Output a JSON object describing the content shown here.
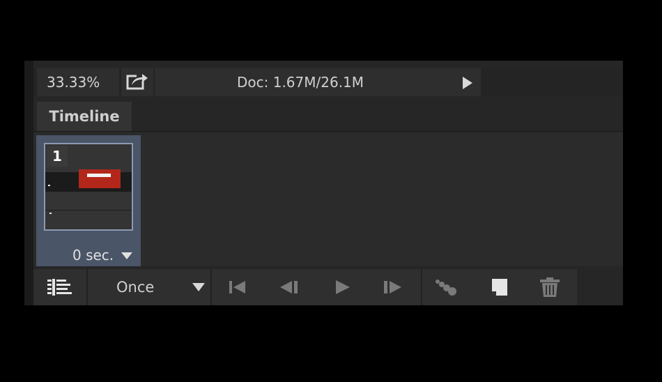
{
  "status": {
    "zoom": "33.33%",
    "doc_info": "Doc: 1.67M/26.1M"
  },
  "panel": {
    "tab_label": "Timeline"
  },
  "frames": [
    {
      "number": "1",
      "delay": "0 sec."
    }
  ],
  "controls": {
    "loop_option": "Once"
  },
  "icons": {
    "export": "export-icon",
    "menu_arrow": "play-arrow-icon",
    "convert": "convert-to-video-timeline-icon",
    "first": "first-frame-icon",
    "prev": "previous-frame-icon",
    "play": "play-icon",
    "next": "next-frame-icon",
    "tween": "tween-icon",
    "duplicate": "duplicate-frame-icon",
    "delete": "trash-icon"
  },
  "colors": {
    "background": "#000000",
    "panel": "#262626",
    "selected_frame": "#4a5568",
    "thumbnail_red": "#b3271b"
  }
}
